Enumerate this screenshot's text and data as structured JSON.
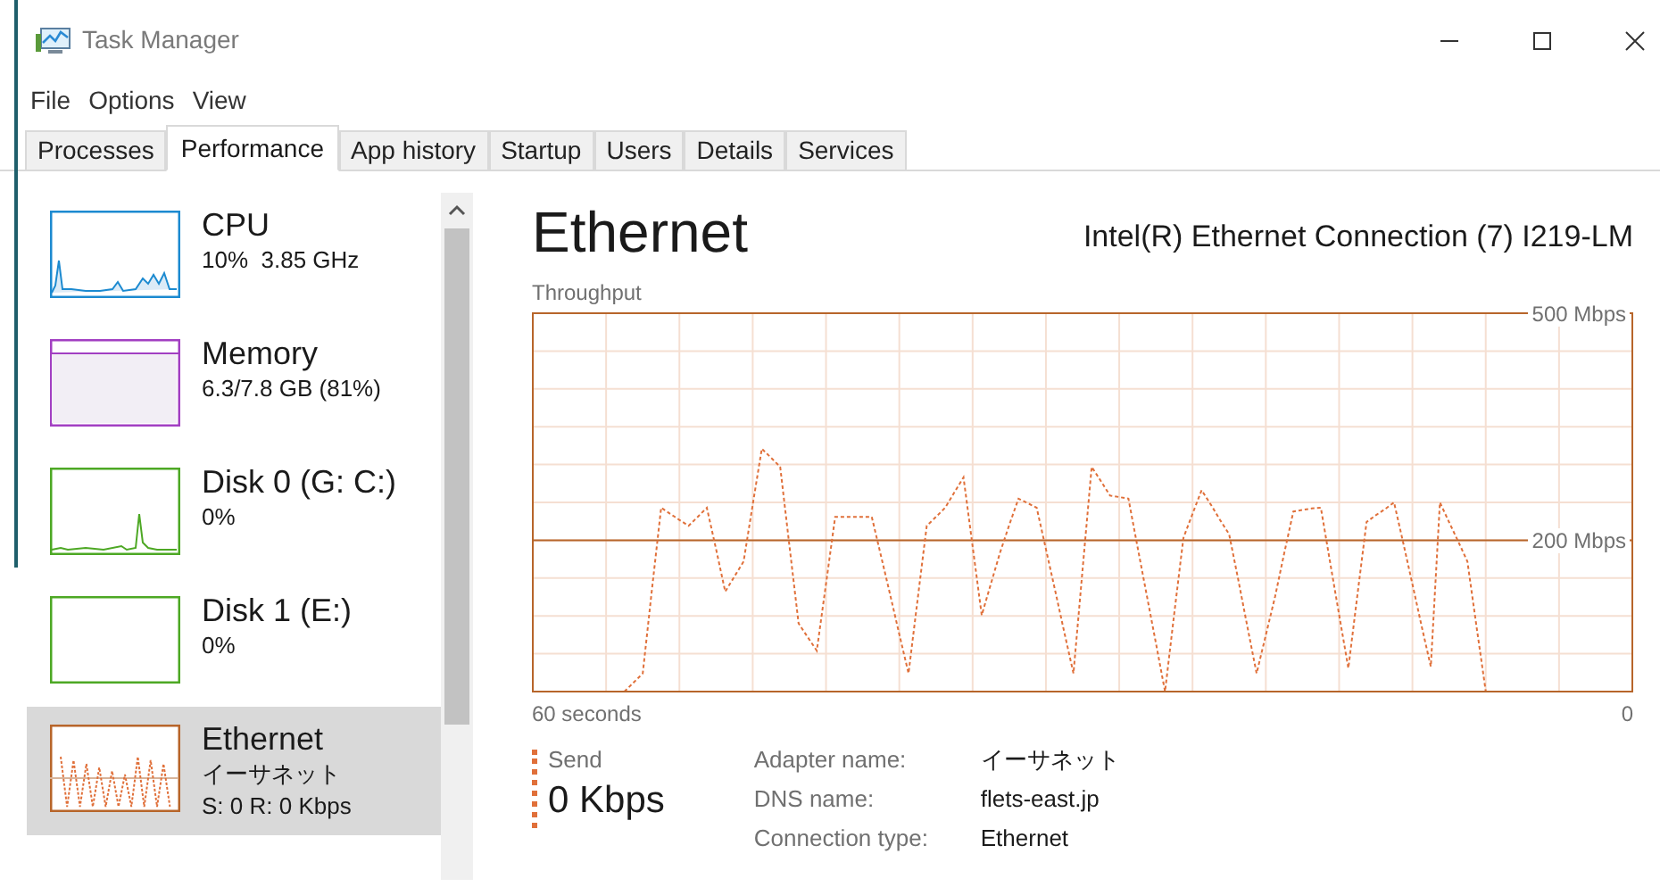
{
  "window": {
    "title": "Task Manager"
  },
  "menu": [
    "File",
    "Options",
    "View"
  ],
  "tabs": [
    {
      "label": "Processes",
      "selected": false
    },
    {
      "label": "Performance",
      "selected": true
    },
    {
      "label": "App history",
      "selected": false
    },
    {
      "label": "Startup",
      "selected": false
    },
    {
      "label": "Users",
      "selected": false
    },
    {
      "label": "Details",
      "selected": false
    },
    {
      "label": "Services",
      "selected": false
    }
  ],
  "sidebar": {
    "items": [
      {
        "kind": "cpu",
        "name": "CPU",
        "lines": [
          "10%  3.85 GHz"
        ],
        "color": "#1c8ad0",
        "selected": false
      },
      {
        "kind": "memory",
        "name": "Memory",
        "lines": [
          "6.3/7.8 GB (81%)"
        ],
        "color": "#a23fc2",
        "selected": false
      },
      {
        "kind": "disk",
        "name": "Disk 0 (G: C:)",
        "lines": [
          "0%"
        ],
        "color": "#4da824",
        "selected": false
      },
      {
        "kind": "idle",
        "name": "Disk 1 (E:)",
        "lines": [
          "0%"
        ],
        "color": "#4da824",
        "selected": false
      },
      {
        "kind": "network",
        "name": "Ethernet",
        "lines": [
          "イーサネット",
          "S: 0 R: 0 Kbps"
        ],
        "color": "#b7652a",
        "selected": true
      }
    ]
  },
  "panel": {
    "title": "Ethernet",
    "device": "Intel(R) Ethernet Connection (7) I219-LM",
    "axis_start": "60 seconds",
    "axis_end": "0",
    "chart_data": {
      "type": "line",
      "title": "Throughput",
      "ylim": [
        0,
        500
      ],
      "grid": true,
      "ref_lines": [
        {
          "axis": "y",
          "value": 200,
          "color": "#b7652a"
        }
      ],
      "yticks": [
        {
          "value": 200,
          "label": "200 Mbps"
        },
        {
          "value": 500,
          "label": "500 Mbps"
        }
      ],
      "categories": [
        null,
        null,
        null,
        null,
        null,
        null,
        null,
        null,
        null,
        null,
        null,
        null,
        null,
        null,
        null,
        null,
        null,
        null,
        null,
        null,
        null,
        null,
        null,
        null,
        null,
        null,
        null,
        null,
        null,
        null,
        null,
        null,
        null,
        null,
        null,
        null,
        null,
        null,
        null,
        null,
        null,
        null,
        null,
        null,
        null,
        null,
        null,
        null,
        null,
        null,
        null,
        null,
        null,
        null,
        null,
        null,
        null,
        null,
        null,
        null,
        null,
        null,
        null,
        null,
        null,
        null,
        null,
        null,
        null,
        null,
        null,
        null,
        null,
        null,
        null,
        null,
        null,
        null,
        null,
        null,
        null,
        null,
        null,
        null,
        null,
        null,
        null,
        null,
        null,
        null,
        null,
        null,
        null,
        null,
        null,
        null,
        null,
        null,
        null,
        null,
        null,
        null,
        null,
        null,
        null,
        null,
        null,
        null,
        null,
        null,
        null,
        null,
        null,
        null,
        null,
        null,
        null,
        null,
        null,
        null,
        null
      ],
      "series": [
        {
          "name": "Send",
          "color": "#e0703a",
          "line_style": "dashed",
          "values": [
            null,
            null,
            null,
            null,
            null,
            null,
            null,
            null,
            null,
            null,
            0,
            12,
            24,
            134,
            243,
            235,
            227,
            219,
            231,
            243,
            188,
            132,
            152,
            172,
            247,
            321,
            309,
            297,
            194,
            90,
            72,
            54,
            143,
            231,
            231,
            231,
            231,
            231,
            179,
            128,
            76,
            24,
            122,
            219,
            231,
            243,
            263,
            283,
            192,
            101,
            143,
            184,
            220,
            255,
            249,
            243,
            188,
            134,
            79,
            24,
            161,
            297,
            278,
            259,
            257,
            255,
            191,
            128,
            64,
            0,
            102,
            203,
            235,
            266,
            247,
            227,
            208,
            147,
            85,
            24,
            75,
            125,
            182,
            238,
            240,
            242,
            243,
            172,
            102,
            31,
            128,
            224,
            233,
            241,
            250,
            196,
            142,
            87,
            33,
            250,
            224,
            198,
            172,
            86,
            0,
            null,
            null,
            null,
            null,
            null,
            null,
            null,
            null,
            null,
            null,
            null,
            null,
            null,
            null,
            null,
            null
          ]
        }
      ]
    },
    "send": {
      "value": "0 Kbps"
    },
    "details": [
      {
        "label": "Adapter name:",
        "value": "イーサネット"
      },
      {
        "label": "DNS name:",
        "value": "flets-east.jp"
      },
      {
        "label": "Connection type:",
        "value": "Ethernet"
      }
    ]
  }
}
